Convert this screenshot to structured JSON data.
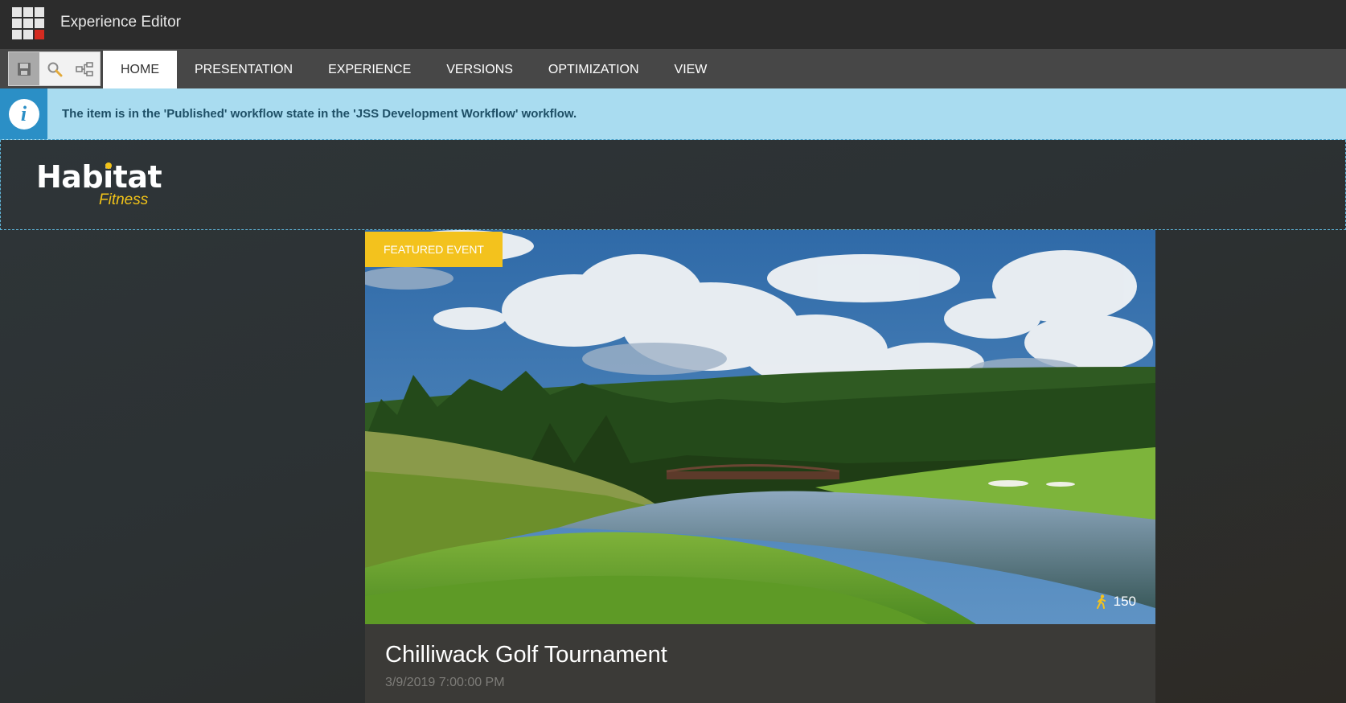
{
  "app": {
    "title": "Experience Editor",
    "menu_icon": "app-grid-icon"
  },
  "ribbon": {
    "quick_tools": [
      {
        "icon": "save-icon"
      },
      {
        "icon": "search-icon"
      },
      {
        "icon": "navigator-icon"
      }
    ],
    "tabs": [
      {
        "label": "HOME",
        "active": true
      },
      {
        "label": "PRESENTATION",
        "active": false
      },
      {
        "label": "EXPERIENCE",
        "active": false
      },
      {
        "label": "VERSIONS",
        "active": false
      },
      {
        "label": "OPTIMIZATION",
        "active": false
      },
      {
        "label": "VIEW",
        "active": false
      }
    ]
  },
  "notification": {
    "icon": "info-icon",
    "message": "The item is in the 'Published' workflow state in the 'JSS Development Workflow' workflow."
  },
  "site": {
    "logo_main": "Habitat",
    "logo_sub": "Fitness",
    "brand_color": "#f2c318"
  },
  "event": {
    "badge": "FEATURED EVENT",
    "attendee_icon": "walking-person-icon",
    "attendee_count": "150",
    "title": "Chilliwack Golf Tournament",
    "date": "3/9/2019 7:00:00 PM"
  }
}
